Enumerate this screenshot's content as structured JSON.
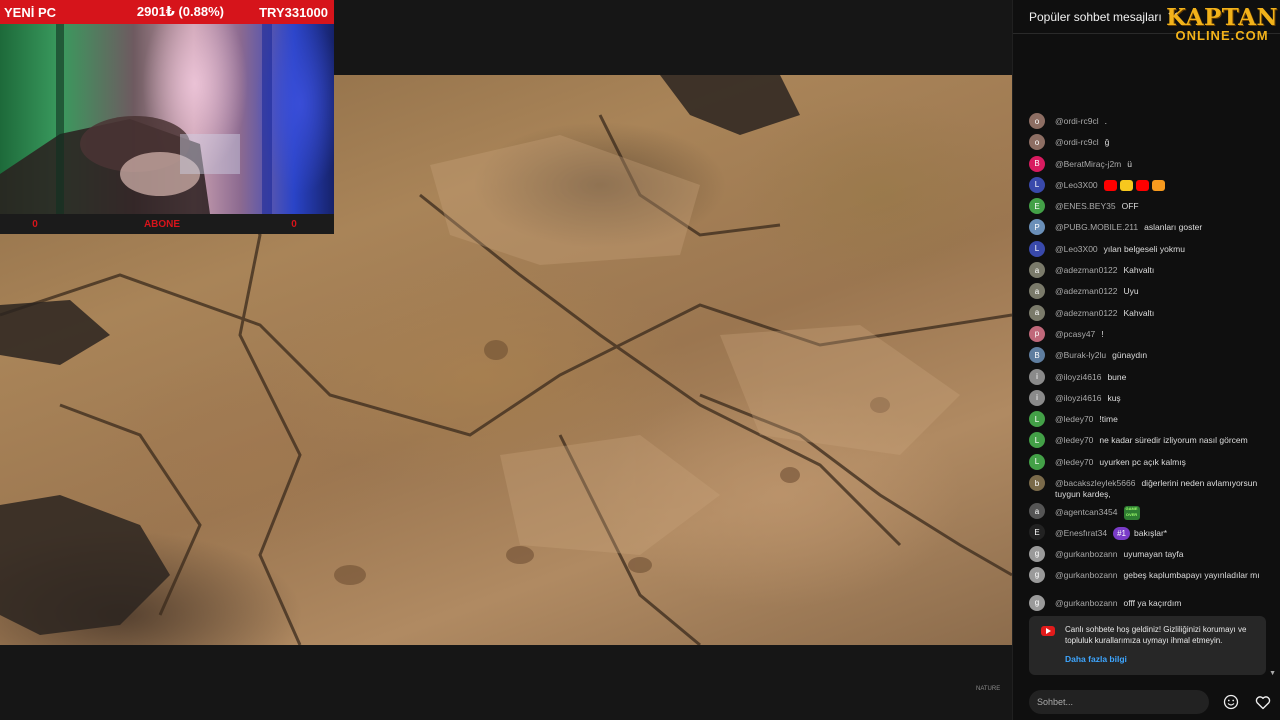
{
  "overlay": {
    "title": "YENİ PC",
    "price_change": "2901₺ (0.88%)",
    "target": "TRY331000",
    "footer_left": "0",
    "footer_mid": "ABONE",
    "footer_right": "0"
  },
  "video": {
    "corner_watermark": "NATURE"
  },
  "chat": {
    "header_label": "Popüler sohbet mesajları",
    "brand_top": "KAPTAN",
    "brand_bottom": "ONLINE.COM",
    "messages": [
      {
        "author": "@ordi-rc9cl",
        "text": ".",
        "avatar_letter": "o",
        "avatar_color": "#8d6e63"
      },
      {
        "author": "@ordi-rc9cl",
        "text": "ğ",
        "avatar_letter": "o",
        "avatar_color": "#8d6e63"
      },
      {
        "author": "@BeratMiraç-j2m",
        "text": "ü",
        "avatar_letter": "B",
        "avatar_color": "#d81b60"
      },
      {
        "author": "@Leo3X00",
        "text": "",
        "avatar_letter": "L",
        "avatar_color": "#3949ab",
        "emojis": [
          "#ff0000",
          "#f7c81e",
          "#ff0000",
          "#f79a1e"
        ]
      },
      {
        "author": "@ENES.BEY35",
        "text": "OFF",
        "avatar_letter": "E",
        "avatar_color": "#43a047"
      },
      {
        "author": "@PUBG.MOBILE.211",
        "text": "aslanları goster",
        "avatar_letter": "P",
        "avatar_color": "#6a8fb8"
      },
      {
        "author": "@Leo3X00",
        "text": "yılan belgeseli yokmu",
        "avatar_letter": "L",
        "avatar_color": "#3949ab"
      },
      {
        "author": "@adezman0122",
        "text": "Kahvaltı",
        "avatar_letter": "a",
        "avatar_color": "#7a7a6a"
      },
      {
        "author": "@adezman0122",
        "text": "Uyu",
        "avatar_letter": "a",
        "avatar_color": "#7a7a6a"
      },
      {
        "author": "@adezman0122",
        "text": "Kahvaltı",
        "avatar_letter": "a",
        "avatar_color": "#7a7a6a"
      },
      {
        "author": "@pcasy47",
        "text": "!",
        "avatar_letter": "p",
        "avatar_color": "#c0687a"
      },
      {
        "author": "@Burak-ly2lu",
        "text": "günaydın",
        "avatar_letter": "B",
        "avatar_color": "#5f7ea0"
      },
      {
        "author": "@iloyzi4616",
        "text": "bune",
        "avatar_letter": "i",
        "avatar_color": "#8a8a8a"
      },
      {
        "author": "@iloyzi4616",
        "text": "kuş",
        "avatar_letter": "i",
        "avatar_color": "#8a8a8a"
      },
      {
        "author": "@ledey70",
        "text": "!time",
        "avatar_letter": "L",
        "avatar_color": "#43a047"
      },
      {
        "author": "@ledey70",
        "text": "ne kadar süredir izliyorum nasıl görcem",
        "avatar_letter": "L",
        "avatar_color": "#43a047"
      },
      {
        "author": "@ledey70",
        "text": "uyurken pc açık kalmış",
        "avatar_letter": "L",
        "avatar_color": "#43a047"
      },
      {
        "author": "@bacakszleylek5666",
        "text": "diğerlerini neden avlamıyorsun tuygun kardeş,",
        "avatar_letter": "b",
        "avatar_color": "#7a6a4a",
        "two_line": true
      },
      {
        "author": "@agentcan3454",
        "text": "",
        "avatar_letter": "a",
        "avatar_color": "#555555",
        "sticker": "GAME OVER"
      },
      {
        "author": "@Enesfırat34",
        "text": "bakışlar*",
        "avatar_letter": "E",
        "avatar_color": "#222222",
        "badge": "#1"
      },
      {
        "author": "@gurkanbozann",
        "text": "uyumayan tayfa",
        "avatar_letter": "g",
        "avatar_color": "#9a9a9a"
      },
      {
        "author": "@gurkanbozann",
        "text": "gebeş kaplumbapayı yayınladılar mı",
        "avatar_letter": "g",
        "avatar_color": "#9a9a9a",
        "two_line": true
      },
      {
        "author": "@gurkanbozann",
        "text": "offf ya kaçırdım",
        "avatar_letter": "g",
        "avatar_color": "#9a9a9a"
      }
    ],
    "notice": {
      "text": "Canlı sohbete hoş geldiniz! Gizliliğinizi korumayı ve topluluk kurallarımıza uymayı ihmal etmeyin.",
      "link": "Daha fazla bilgi"
    },
    "input_placeholder": "Sohbet..."
  }
}
